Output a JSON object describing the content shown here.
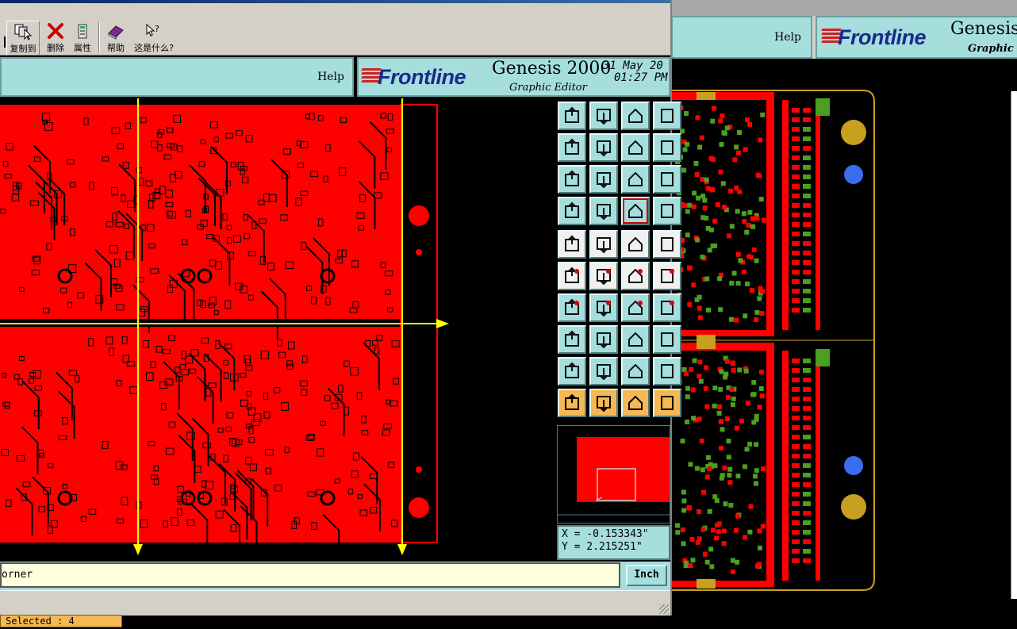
{
  "toolbar": {
    "buttons": [
      {
        "label": "复制到",
        "icon": "copy-to-icon"
      },
      {
        "label": "删除",
        "icon": "delete-icon"
      },
      {
        "label": "属性",
        "icon": "properties-icon"
      },
      {
        "label": "帮助",
        "icon": "help-book-icon"
      },
      {
        "label": "这是什么?",
        "icon": "whats-this-icon"
      }
    ]
  },
  "main_window": {
    "help_label": "Help",
    "logo": {
      "brand": "Frontline",
      "product": "Genesis 2000",
      "subtitle": "Graphic Editor",
      "date": "31 May 20",
      "time": "01:27 PM"
    }
  },
  "background_window": {
    "help_label": "Help",
    "logo": {
      "brand": "Frontline",
      "product": "Genesis",
      "subtitle": "Graphic"
    }
  },
  "coordinates": {
    "x_readout": "X = -0.153343\"",
    "y_readout": "Y = 2.215251\""
  },
  "command_line": {
    "text": "orner"
  },
  "units": {
    "label": "Inch"
  },
  "status": {
    "selected": "Selected : 4"
  },
  "colors": {
    "copper": "#ff0000",
    "panel": "#a6dede",
    "highlight": "#ffff00",
    "pad_gold": "#c8a020",
    "pad_blue": "#3a6cf0",
    "pad_green": "#4aa020"
  }
}
